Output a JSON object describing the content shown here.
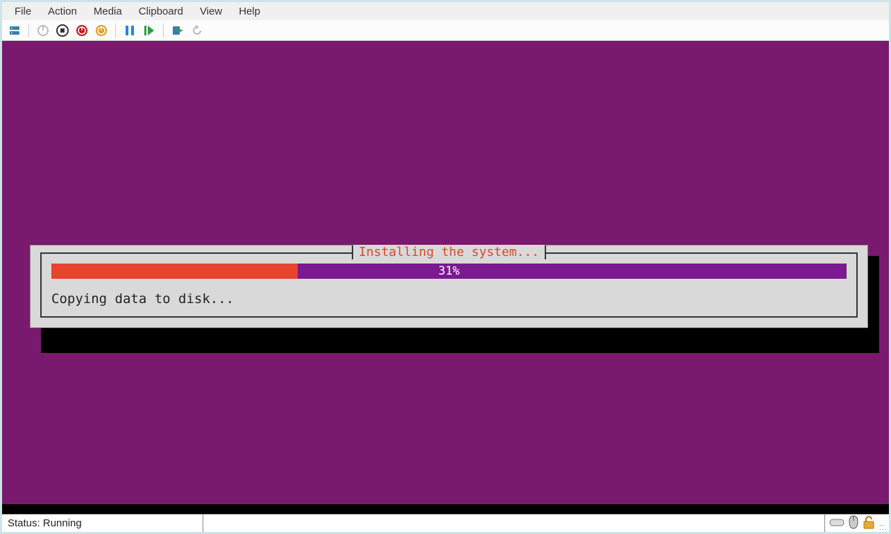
{
  "menu": {
    "items": [
      "File",
      "Action",
      "Media",
      "Clipboard",
      "View",
      "Help"
    ]
  },
  "toolbar": {
    "icons": [
      "server-icon",
      "sep",
      "power-off-icon",
      "stop-icon",
      "shutdown-icon",
      "reset-icon",
      "sep",
      "pause-icon",
      "start-icon",
      "sep",
      "checkpoint-icon",
      "revert-icon"
    ]
  },
  "installer": {
    "title": "Installing the system...",
    "progress_percent": 31,
    "progress_label": "31%",
    "status_text": "Copying data to disk..."
  },
  "statusbar": {
    "text": "Status: Running"
  },
  "colors": {
    "vm_bg": "#7a1a6e",
    "dialog_bg": "#d9d9d9",
    "title_fg": "#d64a2a",
    "progress_fill": "#e8432f",
    "progress_track": "#7a1a8e"
  }
}
